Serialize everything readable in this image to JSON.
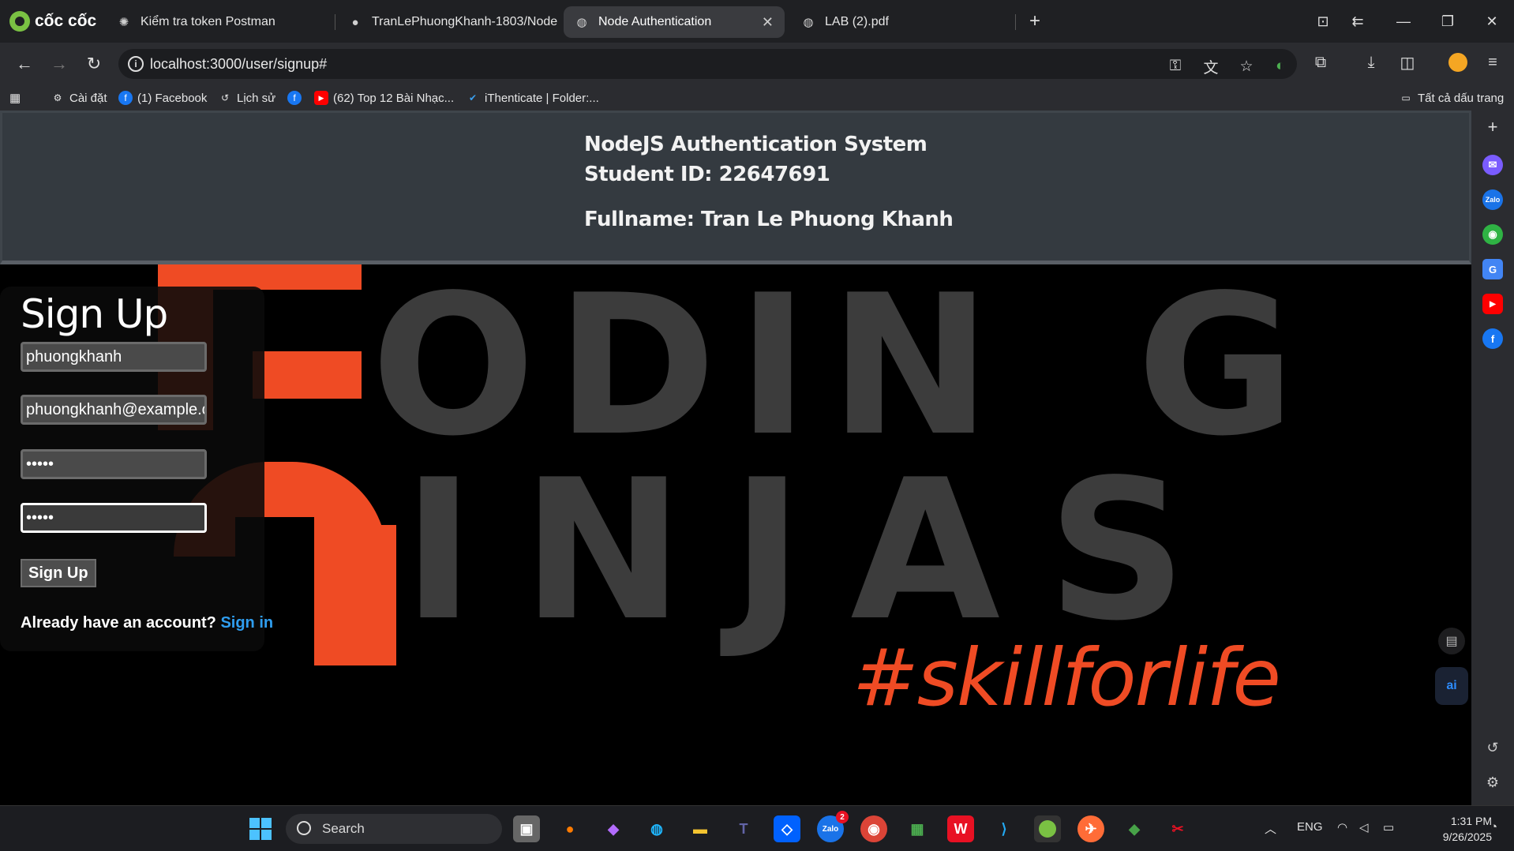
{
  "browser": {
    "brand": "cốc cốc",
    "tabs": [
      {
        "title": "Kiểm tra token Postman",
        "icon": "chatgpt-icon"
      },
      {
        "title": "TranLePhuongKhanh-1803/Node",
        "icon": "github-icon"
      },
      {
        "title": "Node Authentication",
        "icon": "globe-icon",
        "active": true
      },
      {
        "title": "LAB (2).pdf",
        "icon": "globe-icon"
      }
    ],
    "new_tab": "+",
    "url": "localhost:3000/user/signup#",
    "bookmarks": [
      {
        "label": "Cài đặt",
        "icon": "gear-icon"
      },
      {
        "label": "(1) Facebook",
        "icon": "facebook-icon"
      },
      {
        "label": "Lịch sử",
        "icon": "history-icon"
      },
      {
        "label": "",
        "icon": "facebook-icon"
      },
      {
        "label": "(62) Top 12 Bài Nhạc...",
        "icon": "youtube-icon"
      },
      {
        "label": "iThenticate | Folder:...",
        "icon": "check-icon"
      }
    ],
    "all_bookmarks": "Tất cả dấu trang"
  },
  "page": {
    "header": {
      "system": "NodeJS Authentication System",
      "student_id": "Student ID: 22647691",
      "fullname": "Fullname: Tran Le Phuong Khanh"
    },
    "hero": {
      "line1": "ODIN",
      "line2": "INJAS",
      "tagline": "#skillforlife"
    },
    "form": {
      "title": "Sign Up",
      "name_value": "phuongkhanh",
      "email_value": "phuongkhanh@example.com",
      "password_value": "•••••",
      "confirm_value": "•••••",
      "submit_label": "Sign Up",
      "already_text": "Already have an account?",
      "signin_link": "Sign in"
    }
  },
  "taskbar": {
    "search_label": "Search",
    "zalo_badge": "2",
    "language": "ENG",
    "time": "1:31 PM",
    "date": "9/26/2025"
  },
  "colors": {
    "accent_red": "#ef4b24",
    "link_blue": "#2f9ef0",
    "header_bg": "#343a40"
  }
}
